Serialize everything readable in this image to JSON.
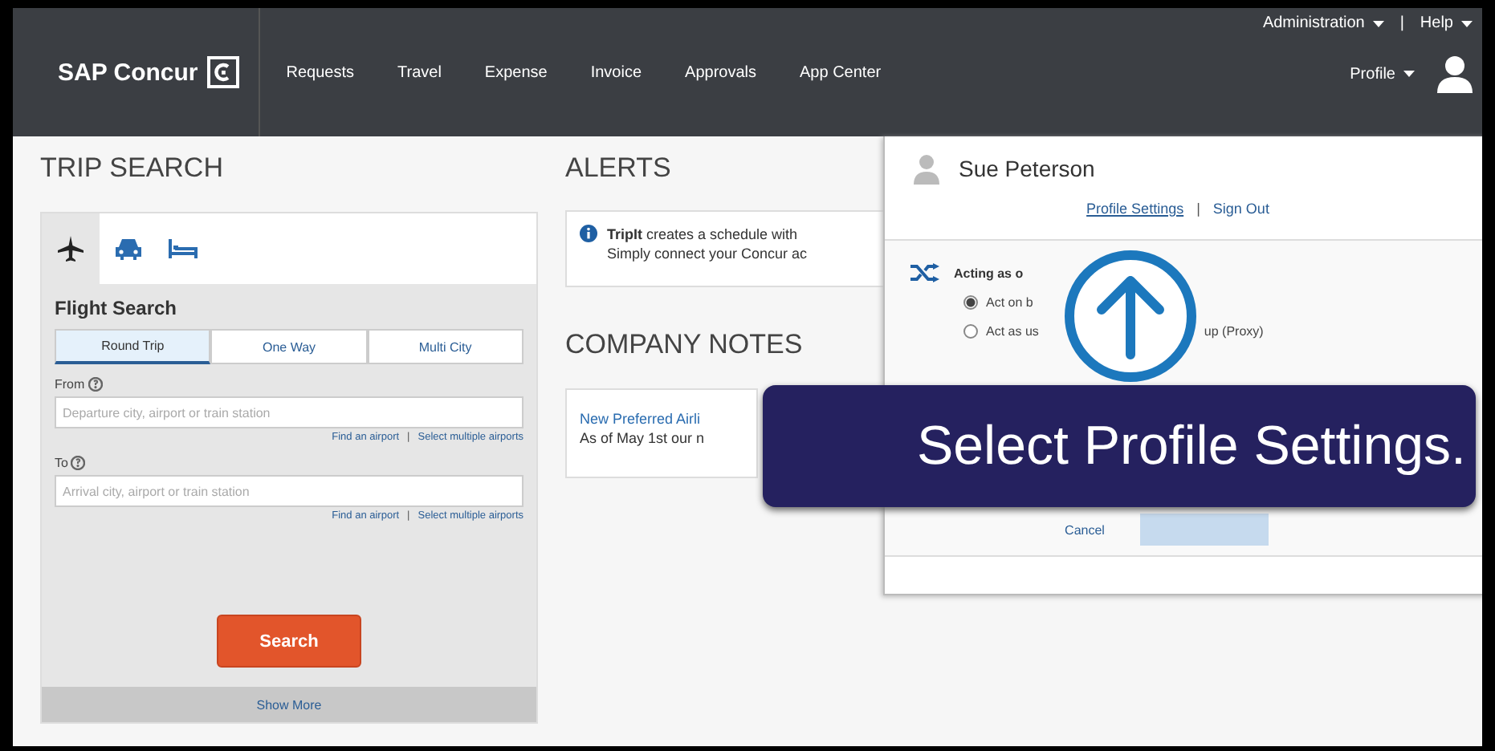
{
  "nav": {
    "logo": "SAP Concur",
    "items": [
      "Requests",
      "Travel",
      "Expense",
      "Invoice",
      "Approvals",
      "App Center"
    ],
    "utility": [
      {
        "label": "Administration"
      },
      {
        "label": "Help"
      }
    ],
    "separator": "|",
    "profile": "Profile"
  },
  "trip_search": {
    "title": "TRIP SEARCH",
    "tabs": [
      {
        "kind": "plane",
        "selected": true
      },
      {
        "kind": "car",
        "selected": false
      },
      {
        "kind": "hotel",
        "selected": false
      }
    ],
    "heading": "Flight Search",
    "trip_types": [
      {
        "label": "Round Trip",
        "selected": true
      },
      {
        "label": "One Way",
        "selected": false
      },
      {
        "label": "Multi City",
        "selected": false
      }
    ],
    "fields": [
      {
        "label": "From",
        "placeholder": "Departure city, airport or train station",
        "links": [
          "Find an airport",
          "Select multiple airports"
        ]
      },
      {
        "label": "To",
        "placeholder": "Arrival city, airport or train station",
        "links": [
          "Find an airport",
          "Select multiple airports"
        ]
      }
    ],
    "link_separator": "|",
    "search_button": "Search",
    "show_more": "Show More"
  },
  "alerts": {
    "title": "ALERTS",
    "lines": [
      "**TripIt** creates a schedule with",
      "Simply connect your Concur ac"
    ]
  },
  "company_notes": {
    "title": "COMPANY NOTES",
    "link": "New Preferred Airli",
    "text": "As of May 1st our n"
  },
  "profile_menu": {
    "name": "Sue Peterson",
    "links": [
      "Profile Settings",
      "Sign Out"
    ],
    "separator": "|",
    "acting_title": "Acting as o",
    "options": [
      {
        "parts": [
          "Act on b"
        ],
        "selected": true
      },
      {
        "parts": [
          "Act as us",
          "up (Proxy)"
        ],
        "selected": false
      }
    ],
    "cancel": "Cancel",
    "start_button": {
      "disabled": true
    }
  },
  "callout": {
    "text": "Select Profile Settings."
  }
}
